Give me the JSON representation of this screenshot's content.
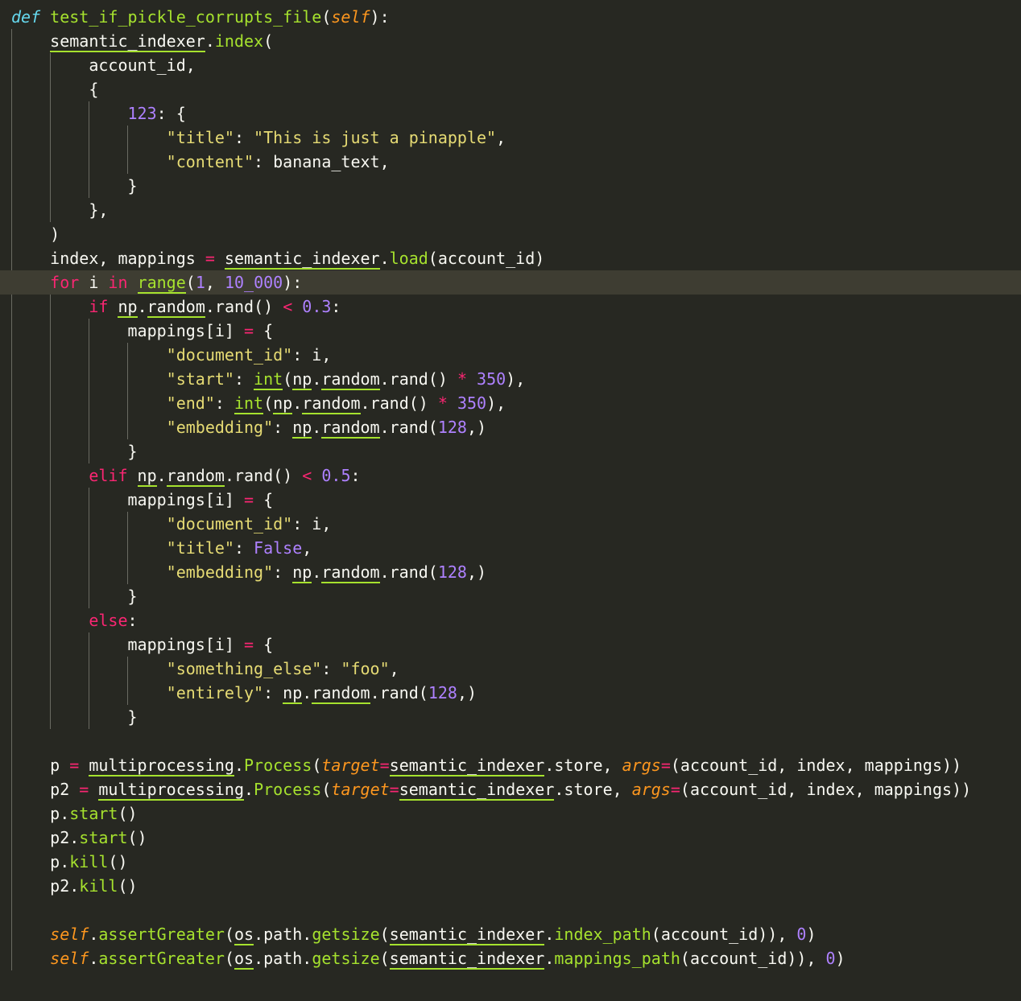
{
  "editor": {
    "highlighted_line": 12,
    "lines": [
      [
        [
          "def",
          "def"
        ],
        [
          " ",
          "plain"
        ],
        [
          "test_if_pickle_corrupts_file",
          "fn"
        ],
        [
          "(",
          "plain"
        ],
        [
          "self",
          "selfk"
        ],
        [
          "):",
          "plain"
        ]
      ],
      [
        [
          "    ",
          "plain"
        ],
        [
          "semantic_indexer",
          "plain",
          "ul"
        ],
        [
          ".",
          "plain"
        ],
        [
          "index",
          "fn"
        ],
        [
          "(",
          "plain"
        ]
      ],
      [
        [
          "        account_id,",
          "plain"
        ]
      ],
      [
        [
          "        {",
          "plain"
        ]
      ],
      [
        [
          "            ",
          "plain"
        ],
        [
          "123",
          "num"
        ],
        [
          ": {",
          "plain"
        ]
      ],
      [
        [
          "                ",
          "plain"
        ],
        [
          "\"title\"",
          "str"
        ],
        [
          ": ",
          "plain"
        ],
        [
          "\"This is just a pinapple\"",
          "str"
        ],
        [
          ",",
          "plain"
        ]
      ],
      [
        [
          "                ",
          "plain"
        ],
        [
          "\"content\"",
          "str"
        ],
        [
          ": banana_text,",
          "plain"
        ]
      ],
      [
        [
          "            }",
          "plain"
        ]
      ],
      [
        [
          "        },",
          "plain"
        ]
      ],
      [
        [
          "    )",
          "plain"
        ]
      ],
      [
        [
          "    index, mappings ",
          "plain"
        ],
        [
          "=",
          "op"
        ],
        [
          " ",
          "plain"
        ],
        [
          "semantic_indexer",
          "plain",
          "ul"
        ],
        [
          ".",
          "plain"
        ],
        [
          "load",
          "fn"
        ],
        [
          "(account_id)",
          "plain"
        ]
      ],
      [
        [
          "    ",
          "plain"
        ],
        [
          "for",
          "kw"
        ],
        [
          " i ",
          "plain"
        ],
        [
          "in",
          "kw"
        ],
        [
          " ",
          "plain"
        ],
        [
          "range",
          "fn",
          "ul"
        ],
        [
          "(",
          "plain"
        ],
        [
          "1",
          "num"
        ],
        [
          ", ",
          "plain"
        ],
        [
          "10_000",
          "num"
        ],
        [
          "):",
          "plain"
        ]
      ],
      [
        [
          "        ",
          "plain"
        ],
        [
          "if",
          "kw"
        ],
        [
          " ",
          "plain"
        ],
        [
          "np",
          "plain",
          "ul"
        ],
        [
          ".",
          "plain"
        ],
        [
          "random",
          "plain",
          "ul"
        ],
        [
          ".rand() ",
          "plain"
        ],
        [
          "<",
          "op"
        ],
        [
          " ",
          "plain"
        ],
        [
          "0.3",
          "num"
        ],
        [
          ":",
          "plain"
        ]
      ],
      [
        [
          "            mappings[i] ",
          "plain"
        ],
        [
          "=",
          "op"
        ],
        [
          " {",
          "plain"
        ]
      ],
      [
        [
          "                ",
          "plain"
        ],
        [
          "\"document_id\"",
          "str"
        ],
        [
          ": i,",
          "plain"
        ]
      ],
      [
        [
          "                ",
          "plain"
        ],
        [
          "\"start\"",
          "str"
        ],
        [
          ": ",
          "plain"
        ],
        [
          "int",
          "fn",
          "ul"
        ],
        [
          "(",
          "plain"
        ],
        [
          "np",
          "plain",
          "ul"
        ],
        [
          ".",
          "plain"
        ],
        [
          "random",
          "plain",
          "ul"
        ],
        [
          ".rand() ",
          "plain"
        ],
        [
          "*",
          "op"
        ],
        [
          " ",
          "plain"
        ],
        [
          "350",
          "num"
        ],
        [
          "),",
          "plain"
        ]
      ],
      [
        [
          "                ",
          "plain"
        ],
        [
          "\"end\"",
          "str"
        ],
        [
          ": ",
          "plain"
        ],
        [
          "int",
          "fn",
          "ul"
        ],
        [
          "(",
          "plain"
        ],
        [
          "np",
          "plain",
          "ul"
        ],
        [
          ".",
          "plain"
        ],
        [
          "random",
          "plain",
          "ul"
        ],
        [
          ".rand() ",
          "plain"
        ],
        [
          "*",
          "op"
        ],
        [
          " ",
          "plain"
        ],
        [
          "350",
          "num"
        ],
        [
          "),",
          "plain"
        ]
      ],
      [
        [
          "                ",
          "plain"
        ],
        [
          "\"embedding\"",
          "str"
        ],
        [
          ": ",
          "plain"
        ],
        [
          "np",
          "plain",
          "ul"
        ],
        [
          ".",
          "plain"
        ],
        [
          "random",
          "plain",
          "ul"
        ],
        [
          ".rand(",
          "plain"
        ],
        [
          "128",
          "num"
        ],
        [
          ",)",
          "plain"
        ]
      ],
      [
        [
          "            }",
          "plain"
        ]
      ],
      [
        [
          "        ",
          "plain"
        ],
        [
          "elif",
          "kw"
        ],
        [
          " ",
          "plain"
        ],
        [
          "np",
          "plain",
          "ul"
        ],
        [
          ".",
          "plain"
        ],
        [
          "random",
          "plain",
          "ul"
        ],
        [
          ".rand() ",
          "plain"
        ],
        [
          "<",
          "op"
        ],
        [
          " ",
          "plain"
        ],
        [
          "0.5",
          "num"
        ],
        [
          ":",
          "plain"
        ]
      ],
      [
        [
          "            mappings[i] ",
          "plain"
        ],
        [
          "=",
          "op"
        ],
        [
          " {",
          "plain"
        ]
      ],
      [
        [
          "                ",
          "plain"
        ],
        [
          "\"document_id\"",
          "str"
        ],
        [
          ": i,",
          "plain"
        ]
      ],
      [
        [
          "                ",
          "plain"
        ],
        [
          "\"title\"",
          "str"
        ],
        [
          ": ",
          "plain"
        ],
        [
          "False",
          "num"
        ],
        [
          ",",
          "plain"
        ]
      ],
      [
        [
          "                ",
          "plain"
        ],
        [
          "\"embedding\"",
          "str"
        ],
        [
          ": ",
          "plain"
        ],
        [
          "np",
          "plain",
          "ul"
        ],
        [
          ".",
          "plain"
        ],
        [
          "random",
          "plain",
          "ul"
        ],
        [
          ".rand(",
          "plain"
        ],
        [
          "128",
          "num"
        ],
        [
          ",)",
          "plain"
        ]
      ],
      [
        [
          "            }",
          "plain"
        ]
      ],
      [
        [
          "        ",
          "plain"
        ],
        [
          "else",
          "kw"
        ],
        [
          ":",
          "plain"
        ]
      ],
      [
        [
          "            mappings[i] ",
          "plain"
        ],
        [
          "=",
          "op"
        ],
        [
          " {",
          "plain"
        ]
      ],
      [
        [
          "                ",
          "plain"
        ],
        [
          "\"something_else\"",
          "str"
        ],
        [
          ": ",
          "plain"
        ],
        [
          "\"foo\"",
          "str"
        ],
        [
          ",",
          "plain"
        ]
      ],
      [
        [
          "                ",
          "plain"
        ],
        [
          "\"entirely\"",
          "str"
        ],
        [
          ": ",
          "plain"
        ],
        [
          "np",
          "plain",
          "ul"
        ],
        [
          ".",
          "plain"
        ],
        [
          "random",
          "plain",
          "ul"
        ],
        [
          ".rand(",
          "plain"
        ],
        [
          "128",
          "num"
        ],
        [
          ",)",
          "plain"
        ]
      ],
      [
        [
          "            }",
          "plain"
        ]
      ],
      [
        [
          "",
          "plain"
        ]
      ],
      [
        [
          "    p ",
          "plain"
        ],
        [
          "=",
          "op"
        ],
        [
          " ",
          "plain"
        ],
        [
          "multiprocessing",
          "plain",
          "ul"
        ],
        [
          ".",
          "plain"
        ],
        [
          "Process",
          "fn"
        ],
        [
          "(",
          "plain"
        ],
        [
          "target",
          "param"
        ],
        [
          "=",
          "op"
        ],
        [
          "semantic_indexer",
          "plain",
          "ul"
        ],
        [
          ".store, ",
          "plain"
        ],
        [
          "args",
          "param"
        ],
        [
          "=",
          "op"
        ],
        [
          "(account_id, index, mappings))",
          "plain"
        ]
      ],
      [
        [
          "    p2 ",
          "plain"
        ],
        [
          "=",
          "op"
        ],
        [
          " ",
          "plain"
        ],
        [
          "multiprocessing",
          "plain",
          "ul"
        ],
        [
          ".",
          "plain"
        ],
        [
          "Process",
          "fn"
        ],
        [
          "(",
          "plain"
        ],
        [
          "target",
          "param"
        ],
        [
          "=",
          "op"
        ],
        [
          "semantic_indexer",
          "plain",
          "ul"
        ],
        [
          ".store, ",
          "plain"
        ],
        [
          "args",
          "param"
        ],
        [
          "=",
          "op"
        ],
        [
          "(account_id, index, mappings))",
          "plain"
        ]
      ],
      [
        [
          "    p.",
          "plain"
        ],
        [
          "start",
          "fn"
        ],
        [
          "()",
          "plain"
        ]
      ],
      [
        [
          "    p2.",
          "plain"
        ],
        [
          "start",
          "fn"
        ],
        [
          "()",
          "plain"
        ]
      ],
      [
        [
          "    p.",
          "plain"
        ],
        [
          "kill",
          "fn"
        ],
        [
          "()",
          "plain"
        ]
      ],
      [
        [
          "    p2.",
          "plain"
        ],
        [
          "kill",
          "fn"
        ],
        [
          "()",
          "plain"
        ]
      ],
      [
        [
          "",
          "plain"
        ]
      ],
      [
        [
          "    ",
          "plain"
        ],
        [
          "self",
          "selfk"
        ],
        [
          ".",
          "plain"
        ],
        [
          "assertGreater",
          "fn"
        ],
        [
          "(",
          "plain"
        ],
        [
          "os",
          "plain",
          "ul"
        ],
        [
          ".path.",
          "plain"
        ],
        [
          "getsize",
          "fn"
        ],
        [
          "(",
          "plain"
        ],
        [
          "semantic_indexer",
          "plain",
          "ul"
        ],
        [
          ".",
          "plain"
        ],
        [
          "index_path",
          "fn"
        ],
        [
          "(account_id)), ",
          "plain"
        ],
        [
          "0",
          "num"
        ],
        [
          ")",
          "plain"
        ]
      ],
      [
        [
          "    ",
          "plain"
        ],
        [
          "self",
          "selfk"
        ],
        [
          ".",
          "plain"
        ],
        [
          "assertGreater",
          "fn"
        ],
        [
          "(",
          "plain"
        ],
        [
          "os",
          "plain",
          "ul"
        ],
        [
          ".path.",
          "plain"
        ],
        [
          "getsize",
          "fn"
        ],
        [
          "(",
          "plain"
        ],
        [
          "semantic_indexer",
          "plain",
          "ul"
        ],
        [
          ".",
          "plain"
        ],
        [
          "mappings_path",
          "fn"
        ],
        [
          "(account_id)), ",
          "plain"
        ],
        [
          "0",
          "num"
        ],
        [
          ")",
          "plain"
        ]
      ]
    ]
  },
  "colors": {
    "background": "#272822",
    "current_line": "#3e3d32",
    "foreground": "#f8f8f2",
    "keyword": "#f92672",
    "def_keyword": "#66d9ef",
    "function": "#a6e22e",
    "number": "#ae81ff",
    "string": "#e6db74",
    "self_param": "#fd971f"
  }
}
